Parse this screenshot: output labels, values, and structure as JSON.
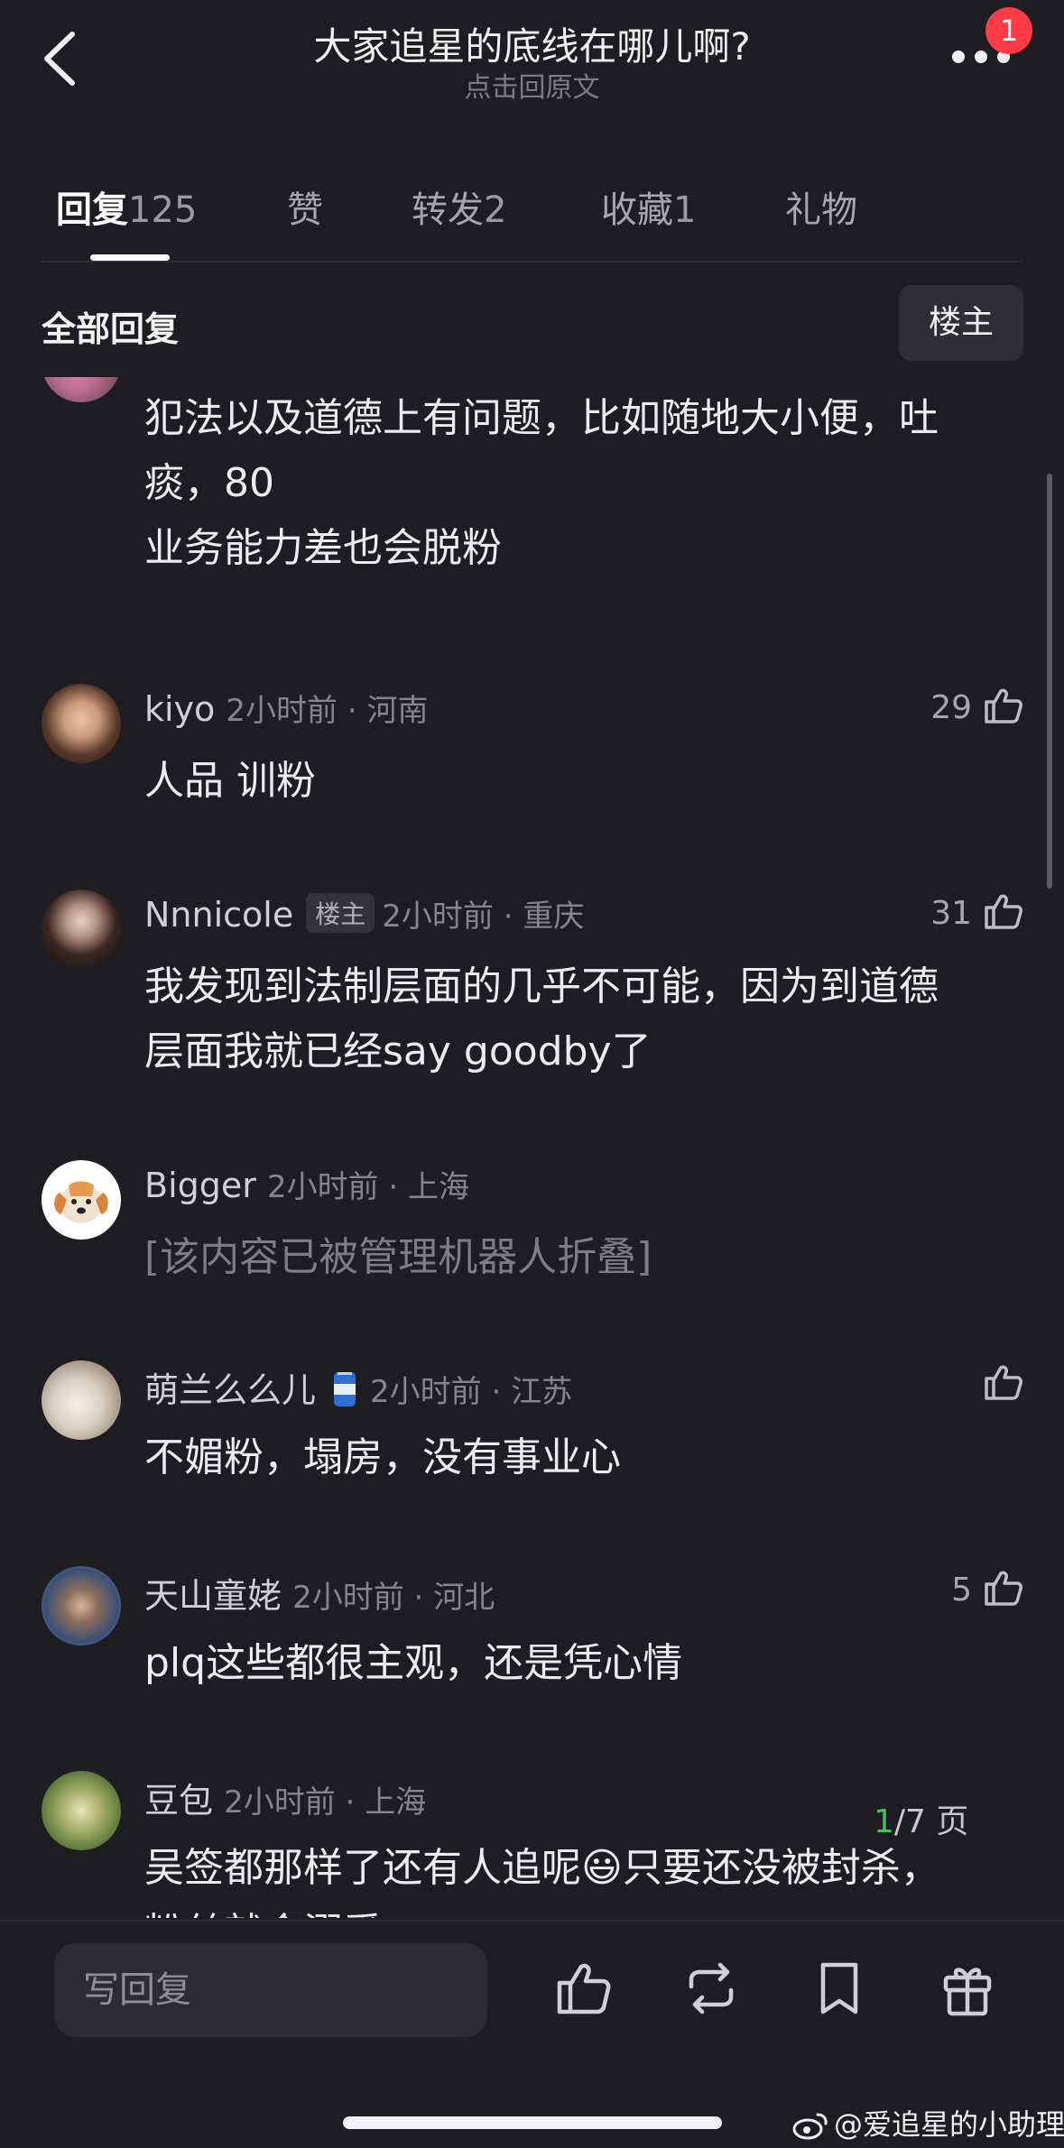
{
  "header": {
    "title": "大家追星的底线在哪儿啊?",
    "subtitle": "点击回原文",
    "notification_count": "1"
  },
  "tabs": [
    {
      "label": "回复",
      "count": "125"
    },
    {
      "label": "赞",
      "count": ""
    },
    {
      "label": "转发",
      "count": "2"
    },
    {
      "label": "收藏",
      "count": "1"
    },
    {
      "label": "礼物",
      "count": ""
    }
  ],
  "filter": {
    "label": "全部回复",
    "owner_button": "楼主"
  },
  "comments": [
    {
      "name": "",
      "time": "",
      "location": "",
      "likes": "",
      "body_lines": [
        "犯法以及道德上有问题，比如随地大小便，吐",
        "痰，80",
        "业务能力差也会脱粉"
      ]
    },
    {
      "name": "kiyo",
      "time": "2小时前",
      "location": "河南",
      "likes": "29",
      "body_lines": [
        "人品 训粉"
      ]
    },
    {
      "name": "Nnnicole",
      "tag": "楼主",
      "time": "2小时前",
      "location": "重庆",
      "likes": "31",
      "body_lines": [
        "我发现到法制层面的几乎不可能，因为到道德",
        "层面我就已经say goodby了"
      ]
    },
    {
      "name": "Bigger",
      "time": "2小时前",
      "location": "上海",
      "likes": "",
      "body_lines": [
        "[该内容已被管理机器人折叠]"
      ]
    },
    {
      "name": "萌兰么么儿",
      "time": "2小时前",
      "location": "江苏",
      "likes": "",
      "body_lines": [
        "不媚粉，塌房，没有事业心"
      ]
    },
    {
      "name": "天山童姥",
      "time": "2小时前",
      "location": "河北",
      "likes": "5",
      "body_lines": [
        "plq这些都很主观，还是凭心情"
      ]
    },
    {
      "name": "豆包",
      "time": "2小时前",
      "location": "上海",
      "likes": "",
      "body_lines": [
        "吴签都那样了还有人追呢😃只要还没被封杀，",
        "粉丝就会溺爱"
      ]
    }
  ],
  "pager": {
    "current": "1",
    "rest": "/7 页"
  },
  "bottom_bar": {
    "reply_placeholder": "写回复"
  },
  "watermark": "@爱追星的小助理",
  "colors": {
    "background": "#1e1e22",
    "badge": "#ff3b45",
    "pager_current": "#4ab96a"
  },
  "icons": [
    "back-arrow-icon",
    "more-dots-icon",
    "thumbs-up-icon",
    "repost-icon",
    "bookmark-icon",
    "gift-icon",
    "weibo-logo-icon"
  ]
}
